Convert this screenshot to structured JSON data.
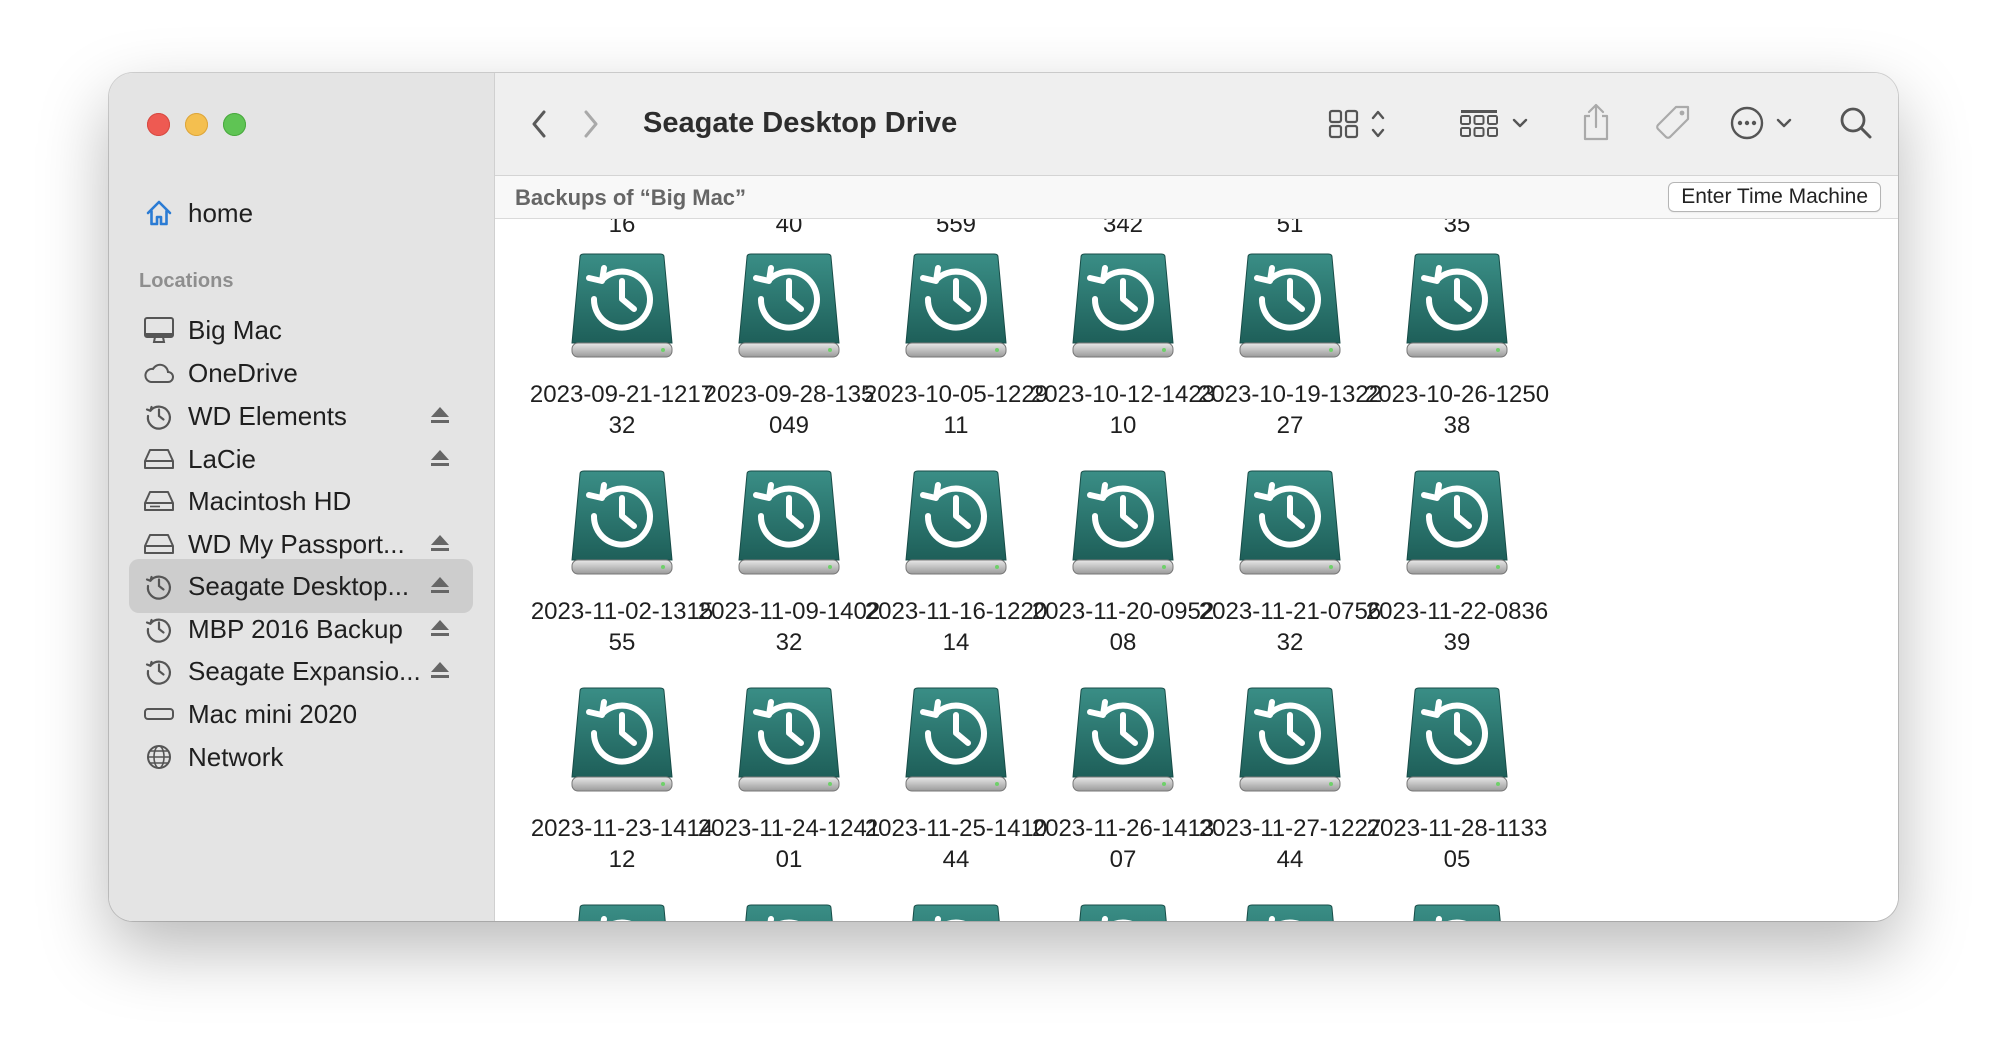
{
  "window": {
    "title": "Seagate Desktop Drive"
  },
  "sidebar": {
    "favorites": [
      {
        "label": "home",
        "icon": "house-icon"
      }
    ],
    "section_title": "Locations",
    "locations": [
      {
        "label": "Big Mac",
        "icon": "desktop-computer-icon",
        "eject": false,
        "selected": false
      },
      {
        "label": "OneDrive",
        "icon": "cloud-icon",
        "eject": false,
        "selected": false
      },
      {
        "label": "WD Elements",
        "icon": "time-machine-icon",
        "eject": true,
        "selected": false
      },
      {
        "label": "LaCie",
        "icon": "external-drive-icon",
        "eject": true,
        "selected": false
      },
      {
        "label": "Macintosh HD",
        "icon": "internal-drive-icon",
        "eject": false,
        "selected": false
      },
      {
        "label": "WD My Passport...",
        "icon": "external-drive-icon",
        "eject": true,
        "selected": false
      },
      {
        "label": "Seagate Desktop...",
        "icon": "time-machine-icon",
        "eject": true,
        "selected": true
      },
      {
        "label": "MBP 2016 Backup",
        "icon": "time-machine-icon",
        "eject": true,
        "selected": false
      },
      {
        "label": "Seagate Expansio...",
        "icon": "time-machine-icon",
        "eject": true,
        "selected": false
      },
      {
        "label": "Mac mini 2020",
        "icon": "mac-mini-icon",
        "eject": false,
        "selected": false
      },
      {
        "label": "Network",
        "icon": "globe-icon",
        "eject": false,
        "selected": false
      }
    ]
  },
  "toolbar": {
    "icons": [
      "back-chevron-icon",
      "forward-chevron-icon",
      "icon-view-icon",
      "group-by-icon",
      "share-icon",
      "tag-icon",
      "more-actions-icon",
      "search-icon"
    ]
  },
  "pathbar": {
    "text": "Backups of “Big Mac”",
    "button_label": "Enter Time Machine"
  },
  "content": {
    "partial_top_labels": [
      "16",
      "40",
      "559",
      "342",
      "51",
      "35"
    ],
    "items": [
      {
        "line1": "2023-09-21-1217",
        "line2": "32"
      },
      {
        "line1": "2023-09-28-135",
        "line2": "049"
      },
      {
        "line1": "2023-10-05-1229",
        "line2": "11"
      },
      {
        "line1": "2023-10-12-1423",
        "line2": "10"
      },
      {
        "line1": "2023-10-19-1322",
        "line2": "27"
      },
      {
        "line1": "2023-10-26-1250",
        "line2": "38"
      },
      {
        "line1": "2023-11-02-1315",
        "line2": "55"
      },
      {
        "line1": "2023-11-09-1402",
        "line2": "32"
      },
      {
        "line1": "2023-11-16-1220",
        "line2": "14"
      },
      {
        "line1": "2023-11-20-0952",
        "line2": "08"
      },
      {
        "line1": "2023-11-21-0756",
        "line2": "32"
      },
      {
        "line1": "2023-11-22-0836",
        "line2": "39"
      },
      {
        "line1": "2023-11-23-1414",
        "line2": "12"
      },
      {
        "line1": "2023-11-24-1241",
        "line2": "01"
      },
      {
        "line1": "2023-11-25-1410",
        "line2": "44"
      },
      {
        "line1": "2023-11-26-1413",
        "line2": "07"
      },
      {
        "line1": "2023-11-27-1227",
        "line2": "44"
      },
      {
        "line1": "2023-11-28-1133",
        "line2": "05"
      }
    ],
    "item_icon": "time-machine-backup-icon"
  },
  "colors": {
    "accent": "#2a7bd4",
    "backup_drive": "#2b7a73",
    "sidebar_bg": "#e4e4e4",
    "selection_bg": "#cdcdcd"
  }
}
